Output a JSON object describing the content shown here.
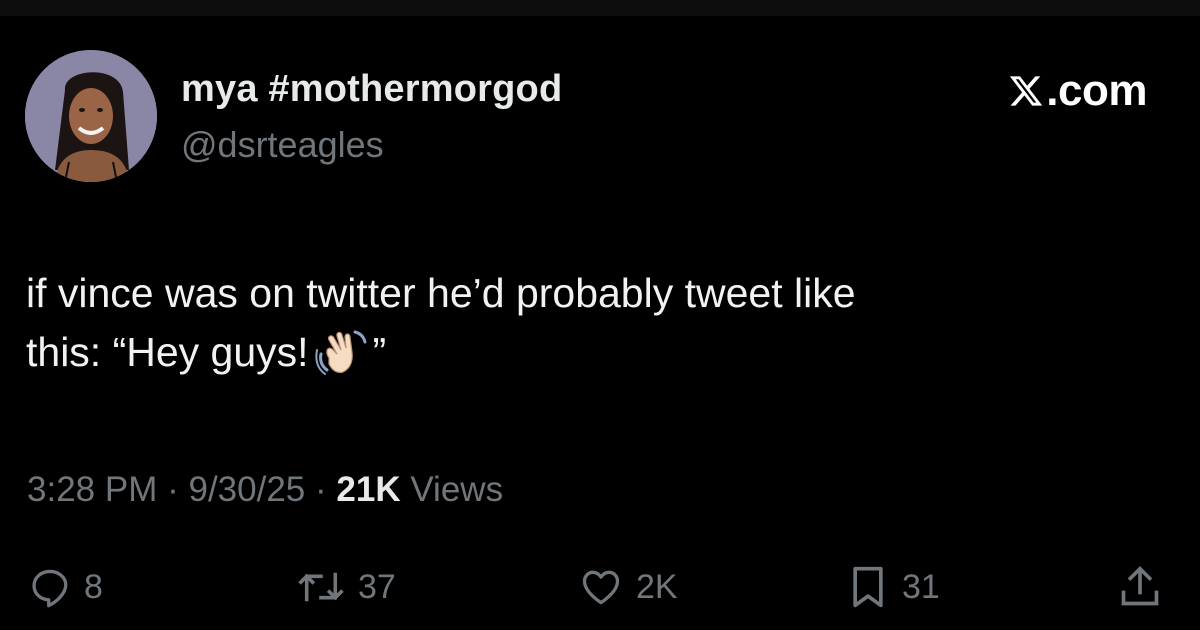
{
  "tweet": {
    "display_name": "mya #mothermorgod",
    "handle": "@dsrteagles",
    "brand": ".com",
    "brand_icon": "x-logo-icon",
    "text_line1": "if vince was on twitter he’d probably tweet like",
    "text_line2_start": "this: “Hey guys!",
    "text_emoji": "waving-hand-emoji",
    "text_line2_end": "”",
    "time": "3:28 PM",
    "separator": "·",
    "date": "9/30/25",
    "views_count": "21K",
    "views_label": "Views"
  },
  "actions": {
    "replies": "8",
    "reposts": "37",
    "likes": "2K",
    "bookmarks": "31"
  },
  "colors": {
    "background": "#000000",
    "text": "#e7e9ea",
    "muted": "#71767b"
  }
}
